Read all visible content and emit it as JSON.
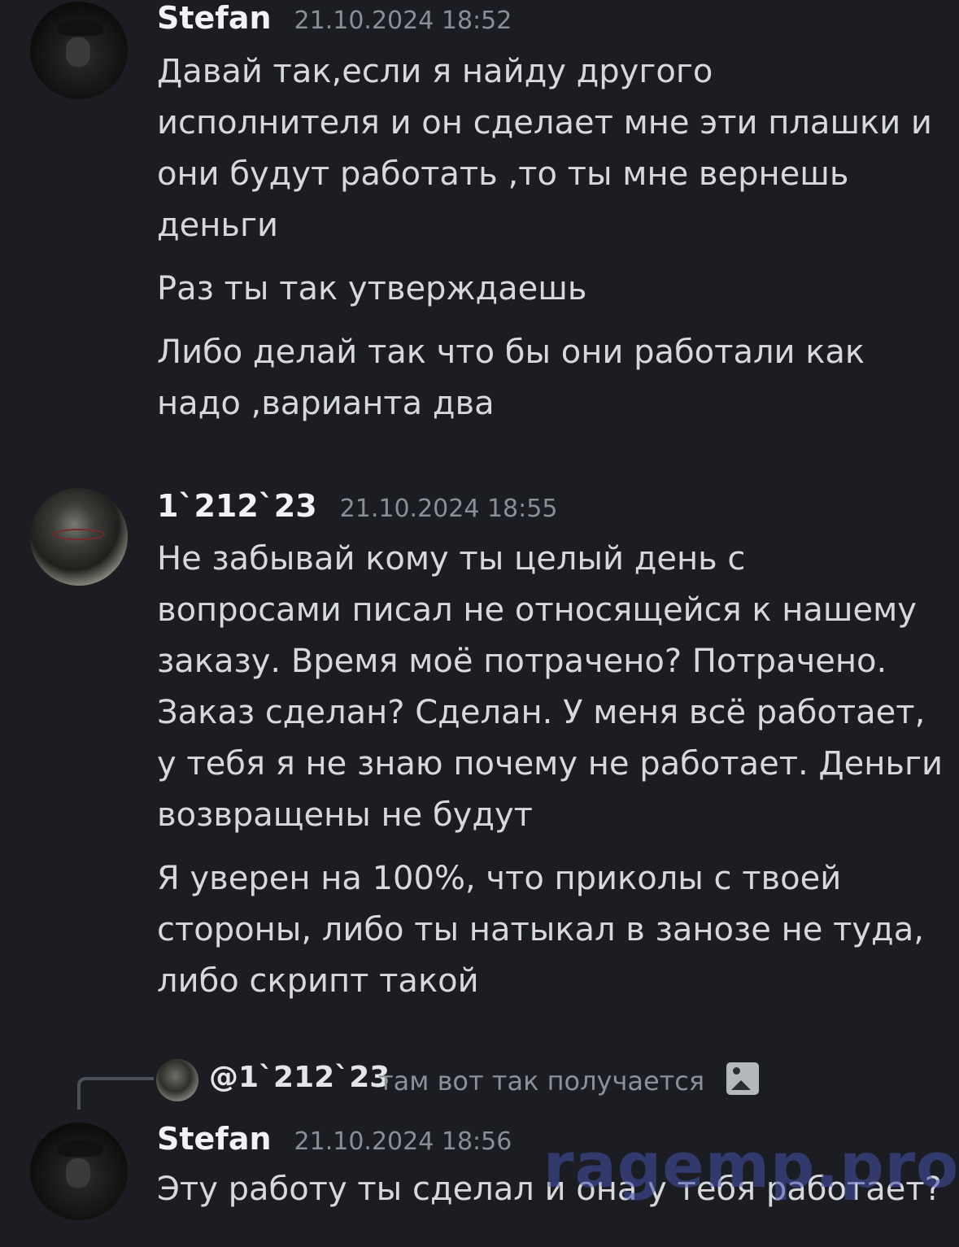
{
  "messages": [
    {
      "author": "Stefan",
      "timestamp": "21.10.2024 18:52",
      "paragraphs": [
        [
          "Давай так,если я найду другого",
          "исполнителя и он сделает мне эти плашки и",
          "они будут работать ,то ты мне вернешь",
          "деньги"
        ],
        [
          "Раз ты так утверждаешь"
        ],
        [
          "Либо делай так что бы они работали как",
          "надо ,варианта два"
        ]
      ]
    },
    {
      "author": "1`212`23",
      "timestamp": "21.10.2024 18:55",
      "paragraphs": [
        [
          "Не забывай кому ты целый день с",
          "вопросами писал не относящейся к нашему",
          "заказу. Время моё потрачено? Потрачено.",
          "Заказ сделан? Сделан. У меня всё работает,",
          "у тебя я не знаю почему не работает. Деньги",
          "возвращены не будут"
        ],
        [
          "Я уверен на 100%, что приколы с твоей",
          "стороны, либо ты натыкал в занозе не туда,",
          "либо скрипт такой"
        ]
      ]
    },
    {
      "author": "Stefan",
      "timestamp": "21.10.2024 18:56",
      "reply": {
        "mention": "@1`212`23",
        "text": "там вот так получается",
        "attachment_icon": "image-icon"
      },
      "paragraphs": [
        [
          "Эту работу ты сделал и она у тебя работает?"
        ]
      ]
    }
  ],
  "watermark": "ragemp.pro"
}
